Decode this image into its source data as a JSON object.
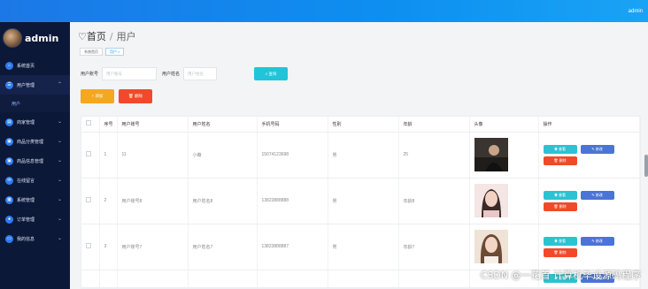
{
  "header": {
    "user": "admin"
  },
  "sidebar": {
    "brand": "admin",
    "items": [
      {
        "label": "系统首页",
        "icon": "home-icon",
        "glyph": "⌂",
        "chevron": ""
      },
      {
        "label": "用户管理",
        "icon": "users-icon",
        "glyph": "☰",
        "chevron": "⌃",
        "active": true
      },
      {
        "label": "商家管理",
        "icon": "store-icon",
        "glyph": "▤",
        "chevron": "⌄"
      },
      {
        "label": "商品分类管理",
        "icon": "category-icon",
        "glyph": "▣",
        "chevron": "⌄"
      },
      {
        "label": "商品信息管理",
        "icon": "product-icon",
        "glyph": "▣",
        "chevron": "⌄"
      },
      {
        "label": "在线留言",
        "icon": "message-icon",
        "glyph": "✉",
        "chevron": "⌄"
      },
      {
        "label": "系统管理",
        "icon": "settings-icon",
        "glyph": "▦",
        "chevron": "⌄"
      },
      {
        "label": "订单管理",
        "icon": "order-icon",
        "glyph": "●",
        "chevron": "⌄"
      },
      {
        "label": "我的信息",
        "icon": "profile-icon",
        "glyph": "▭",
        "chevron": "⌄"
      }
    ],
    "sub_item": "用户"
  },
  "breadcrumb": {
    "home": "首页",
    "sep": "/",
    "current": "用户"
  },
  "tags": [
    "系统首页",
    "用户 ×"
  ],
  "search": {
    "account_label": "用户账号",
    "account_placeholder": "用户账号",
    "name_label": "用户姓名",
    "name_placeholder": "用户姓名",
    "button": "⌕ 查询"
  },
  "actions": {
    "add": "+ 添加",
    "delete": "🗑 删除"
  },
  "table": {
    "headers": [
      "",
      "序号",
      "用户账号",
      "用户姓名",
      "手机号码",
      "性别",
      "年龄",
      "头像",
      "操作"
    ],
    "rows": [
      {
        "index": "1",
        "account": "11",
        "name": "小薇",
        "phone": "15074123698",
        "gender": "男",
        "age": "25"
      },
      {
        "index": "2",
        "account": "用户账号8",
        "name": "用户姓名8",
        "phone": "13823888888",
        "gender": "男",
        "age": "年龄8"
      },
      {
        "index": "3",
        "account": "用户账号7",
        "name": "用户姓名7",
        "phone": "13823888887",
        "gender": "男",
        "age": "年龄7"
      }
    ],
    "op_view": "◉ 查看",
    "op_edit": "✎ 修改",
    "op_delete": "🗑 删除"
  },
  "watermark": "CSDN @一花首  计算机毕设源码程序",
  "colors": {
    "topbar": "#1c78e6",
    "sidebar": "#0c1838",
    "search_btn": "#22c4d8",
    "add_btn": "#f5a623",
    "delete_btn": "#f04a2a",
    "view_btn": "#2bc3d3",
    "edit_btn": "#4a74d8"
  }
}
